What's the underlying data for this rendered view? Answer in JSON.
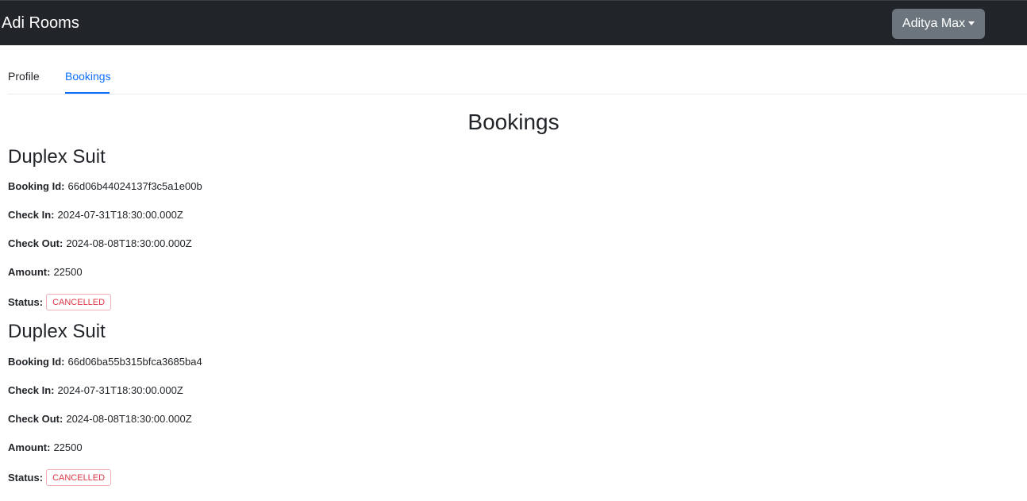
{
  "navbar": {
    "brand": "Adi Rooms",
    "user_menu_label": "Aditya Max"
  },
  "tabs": [
    {
      "label": "Profile",
      "active": false
    },
    {
      "label": "Bookings",
      "active": true
    }
  ],
  "main": {
    "title": "Bookings",
    "labels": {
      "booking_id": "Booking Id:",
      "check_in": "Check In:",
      "check_out": "Check Out:",
      "amount": "Amount:",
      "status": "Status:"
    },
    "bookings": [
      {
        "room_name": "Duplex Suit",
        "booking_id": "66d06b44024137f3c5a1e00b",
        "check_in": "2024-07-31T18:30:00.000Z",
        "check_out": "2024-08-08T18:30:00.000Z",
        "amount": "22500",
        "status": "CANCELLED"
      },
      {
        "room_name": "Duplex Suit",
        "booking_id": "66d06ba55b315bfca3685ba4",
        "check_in": "2024-07-31T18:30:00.000Z",
        "check_out": "2024-08-08T18:30:00.000Z",
        "amount": "22500",
        "status": "CANCELLED"
      }
    ]
  },
  "colors": {
    "navbar_bg": "#212529",
    "user_button_bg": "#6c757d",
    "active_tab": "#0d6efd",
    "status_cancelled": "#dc3545"
  }
}
